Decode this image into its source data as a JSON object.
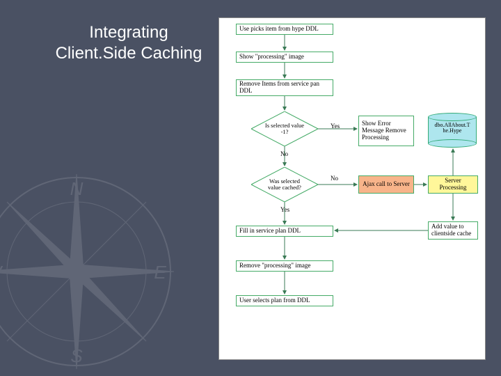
{
  "title_line1": "Integrating",
  "title_line2": "Client.Side Caching",
  "chart_data": {
    "type": "flowchart",
    "title": "Integrating Client.Side Caching",
    "nodes": [
      {
        "id": "n1",
        "type": "process",
        "label": "Use picks item from hype DDL"
      },
      {
        "id": "n2",
        "type": "process",
        "label": "Show \"processing\" image"
      },
      {
        "id": "n3",
        "type": "process",
        "label": "Remove Items from service pan DDL"
      },
      {
        "id": "d1",
        "type": "decision",
        "label": "Is selected value -1?"
      },
      {
        "id": "n4",
        "type": "process",
        "label": "Show Error Message Remove Processing"
      },
      {
        "id": "db",
        "type": "datastore",
        "label": "dbo.AllAbout.T he.Hype"
      },
      {
        "id": "d2",
        "type": "decision",
        "label": "Was selected value cached?"
      },
      {
        "id": "n5",
        "type": "process",
        "label": "Ajax call to Server",
        "color": "orange"
      },
      {
        "id": "n6",
        "type": "process",
        "label": "Server Processing",
        "color": "yellow"
      },
      {
        "id": "n7",
        "type": "process",
        "label": "Fill in service plan DDL"
      },
      {
        "id": "n8",
        "type": "process",
        "label": "Add value to clientside cache"
      },
      {
        "id": "n9",
        "type": "process",
        "label": "Remove \"processing\" image"
      },
      {
        "id": "n10",
        "type": "process",
        "label": "User selects plan from DDL"
      }
    ],
    "edges": [
      {
        "from": "n1",
        "to": "n2"
      },
      {
        "from": "n2",
        "to": "n3"
      },
      {
        "from": "n3",
        "to": "d1"
      },
      {
        "from": "d1",
        "to": "n4",
        "label": "Yes"
      },
      {
        "from": "d1",
        "to": "d2",
        "label": "No"
      },
      {
        "from": "d2",
        "to": "n5",
        "label": "No"
      },
      {
        "from": "d2",
        "to": "n7",
        "label": "Yes"
      },
      {
        "from": "n5",
        "to": "n6"
      },
      {
        "from": "n6",
        "to": "db"
      },
      {
        "from": "n6",
        "to": "n8"
      },
      {
        "from": "n8",
        "to": "n7"
      },
      {
        "from": "n7",
        "to": "n9"
      },
      {
        "from": "n9",
        "to": "n10"
      }
    ],
    "edge_labels": {
      "yes": "Yes",
      "no": "No"
    }
  }
}
